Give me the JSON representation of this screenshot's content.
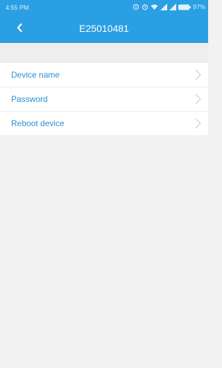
{
  "status": {
    "time": "4:55 PM",
    "battery": "97%",
    "icons": [
      "sync-icon",
      "alarm-icon",
      "wifi-icon",
      "signal-icon",
      "signal-icon",
      "battery-icon"
    ]
  },
  "header": {
    "title": "E25010481",
    "back_icon": "back-chevron-icon",
    "background": "#2a9fe3"
  },
  "menu": {
    "items": [
      {
        "label": "Device name"
      },
      {
        "label": "Password"
      },
      {
        "label": "Reboot device"
      }
    ],
    "label_color": "#2a8fd8",
    "chevron_icon": "chevron-right-icon"
  }
}
